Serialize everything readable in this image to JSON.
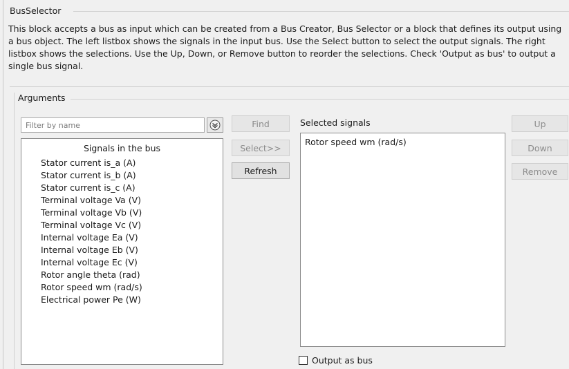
{
  "dialog": {
    "block_name": "BusSelector",
    "description": "This block accepts a bus as input which can be created from a Bus Creator, Bus Selector or a block that defines its output using a bus object. The left listbox shows the signals in the input bus. Use the Select button to select the output signals. The right listbox shows the selections. Use the Up, Down, or Remove button to reorder the selections. Check 'Output as bus' to output a single bus signal."
  },
  "arguments": {
    "title": "Arguments",
    "filter": {
      "placeholder": "Filter by name",
      "value": ""
    },
    "signals_list": {
      "header": "Signals in the bus",
      "items": [
        "Stator current is_a (A)",
        "Stator current is_b (A)",
        "Stator current is_c (A)",
        "Terminal voltage Va (V)",
        "Terminal voltage Vb (V)",
        "Terminal voltage Vc (V)",
        "Internal voltage Ea (V)",
        "Internal voltage Eb (V)",
        "Internal voltage Ec (V)",
        "Rotor angle theta (rad)",
        "Rotor speed wm (rad/s)",
        "Electrical power Pe (W)"
      ]
    },
    "buttons": {
      "find": "Find",
      "select": "Select>>",
      "refresh": "Refresh",
      "up": "Up",
      "down": "Down",
      "remove": "Remove"
    },
    "selected": {
      "label": "Selected signals",
      "items": [
        "Rotor speed wm (rad/s)"
      ]
    },
    "output_as_bus": {
      "label": "Output as bus",
      "checked": false
    }
  },
  "icons": {
    "filter_options": "chevron-down-circle-icon",
    "checkbox": "checkbox-icon"
  },
  "colors": {
    "background": "#f0f0f0",
    "list_background": "#ffffff",
    "disabled_text": "#8c8c8c"
  }
}
